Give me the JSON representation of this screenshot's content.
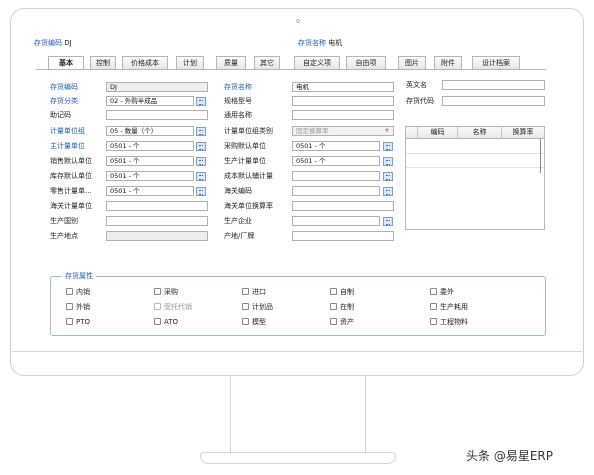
{
  "header": {
    "code_label": "存货编码",
    "code_value": "DJ",
    "name_label": "存货名称",
    "name_value": "电机"
  },
  "tabs": [
    {
      "label": "基本",
      "active": true
    },
    {
      "label": "控制"
    },
    {
      "label": "价格成本"
    },
    {
      "label": "计划"
    },
    {
      "label": "质量"
    },
    {
      "label": "其它"
    },
    {
      "label": "自定义项"
    },
    {
      "label": "自由项"
    },
    {
      "label": "图片"
    },
    {
      "label": "附件"
    },
    {
      "label": "设计档案"
    }
  ],
  "col1": [
    {
      "label": "存货编码",
      "value": "DJ"
    },
    {
      "label": "存货分类",
      "value": "02 - 外购半成品"
    },
    {
      "label": "助记码",
      "value": ""
    },
    {
      "label": "计量单位组",
      "value": "05 - 数量（个）"
    },
    {
      "label": "主计量单位",
      "value": "0501 - 个"
    },
    {
      "label": "销售默认单位",
      "value": "0501 - 个"
    },
    {
      "label": "库存默认单位",
      "value": "0501 - 个"
    },
    {
      "label": "零售计量单...",
      "value": "0501 - 个"
    },
    {
      "label": "海关计量单位",
      "value": ""
    },
    {
      "label": "生产国别",
      "value": ""
    },
    {
      "label": "生产地点",
      "value": ""
    }
  ],
  "col2": [
    {
      "label": "存货名称",
      "value": "电机"
    },
    {
      "label": "规格型号",
      "value": ""
    },
    {
      "label": "通用名称",
      "value": ""
    },
    {
      "label": "计量单位组类别",
      "value": "固定换算率"
    },
    {
      "label": "采购默认单位",
      "value": "0501 - 个"
    },
    {
      "label": "生产计量单位",
      "value": "0501 - 个"
    },
    {
      "label": "成本默认辅计量",
      "value": ""
    },
    {
      "label": "海关编码",
      "value": ""
    },
    {
      "label": "海关单位换算率",
      "value": ""
    },
    {
      "label": "生产企业",
      "value": ""
    },
    {
      "label": "产地/厂牌",
      "value": ""
    }
  ],
  "col3": [
    {
      "label": "英文名",
      "value": ""
    },
    {
      "label": "存货代码",
      "value": ""
    }
  ],
  "grid_headers": [
    "编码",
    "名称",
    "换算率"
  ],
  "attributes": {
    "title": "存货属性",
    "items": [
      {
        "label": "内销",
        "disabled": false
      },
      {
        "label": "采购",
        "disabled": false
      },
      {
        "label": "进口",
        "disabled": false
      },
      {
        "label": "自制",
        "disabled": false
      },
      {
        "label": "委外",
        "disabled": false
      },
      {
        "label": "外销",
        "disabled": false
      },
      {
        "label": "受托代销",
        "disabled": true
      },
      {
        "label": "计划品",
        "disabled": false
      },
      {
        "label": "在制",
        "disabled": false
      },
      {
        "label": "生产耗用",
        "disabled": false
      },
      {
        "label": "PTO",
        "disabled": false
      },
      {
        "label": "ATO",
        "disabled": false
      },
      {
        "label": "模型",
        "disabled": false
      },
      {
        "label": "资产",
        "disabled": false
      },
      {
        "label": "工程物料",
        "disabled": false
      }
    ]
  },
  "watermark": "头条 @易星ERP"
}
